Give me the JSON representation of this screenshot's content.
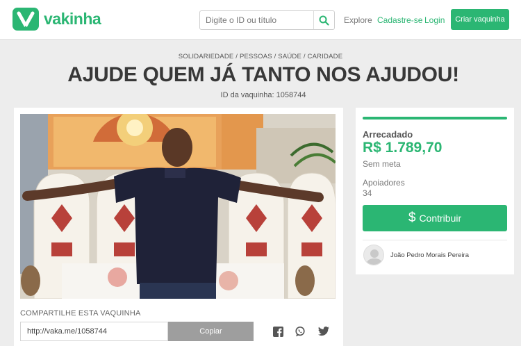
{
  "header": {
    "logo_text": "vakinha",
    "search_placeholder": "Digite o ID ou título",
    "nav": {
      "explore": "Explore",
      "cadastre": "Cadastre-se",
      "login": "Login"
    },
    "cta": "Criar vaquinha"
  },
  "campaign": {
    "categories": "SOLIDARIEDADE / PESSOAS / SAÚDE / CARIDADE",
    "title": "AJUDE QUEM JÁ TANTO NOS AJUDOU!",
    "id_text": "ID da vaquinha: 1058744"
  },
  "share": {
    "label": "COMPARTILHE ESTA VAQUINHA",
    "url": "http://vaka.me/1058744",
    "copy_button": "Copiar",
    "icons": [
      "facebook-icon",
      "whatsapp-icon",
      "twitter-icon"
    ]
  },
  "stats": {
    "raised_label": "Arrecadado",
    "raised_value": "R$ 1.789,70",
    "goal_text": "Sem meta",
    "supporters_label": "Apoiadores",
    "supporters_value": "34",
    "contribute_button": "Contribuir",
    "owner_name": "João Pedro Morais Pereira"
  },
  "colors": {
    "brand": "#2bb673",
    "copy_button": "#9e9e9e",
    "background": "#ededed"
  }
}
